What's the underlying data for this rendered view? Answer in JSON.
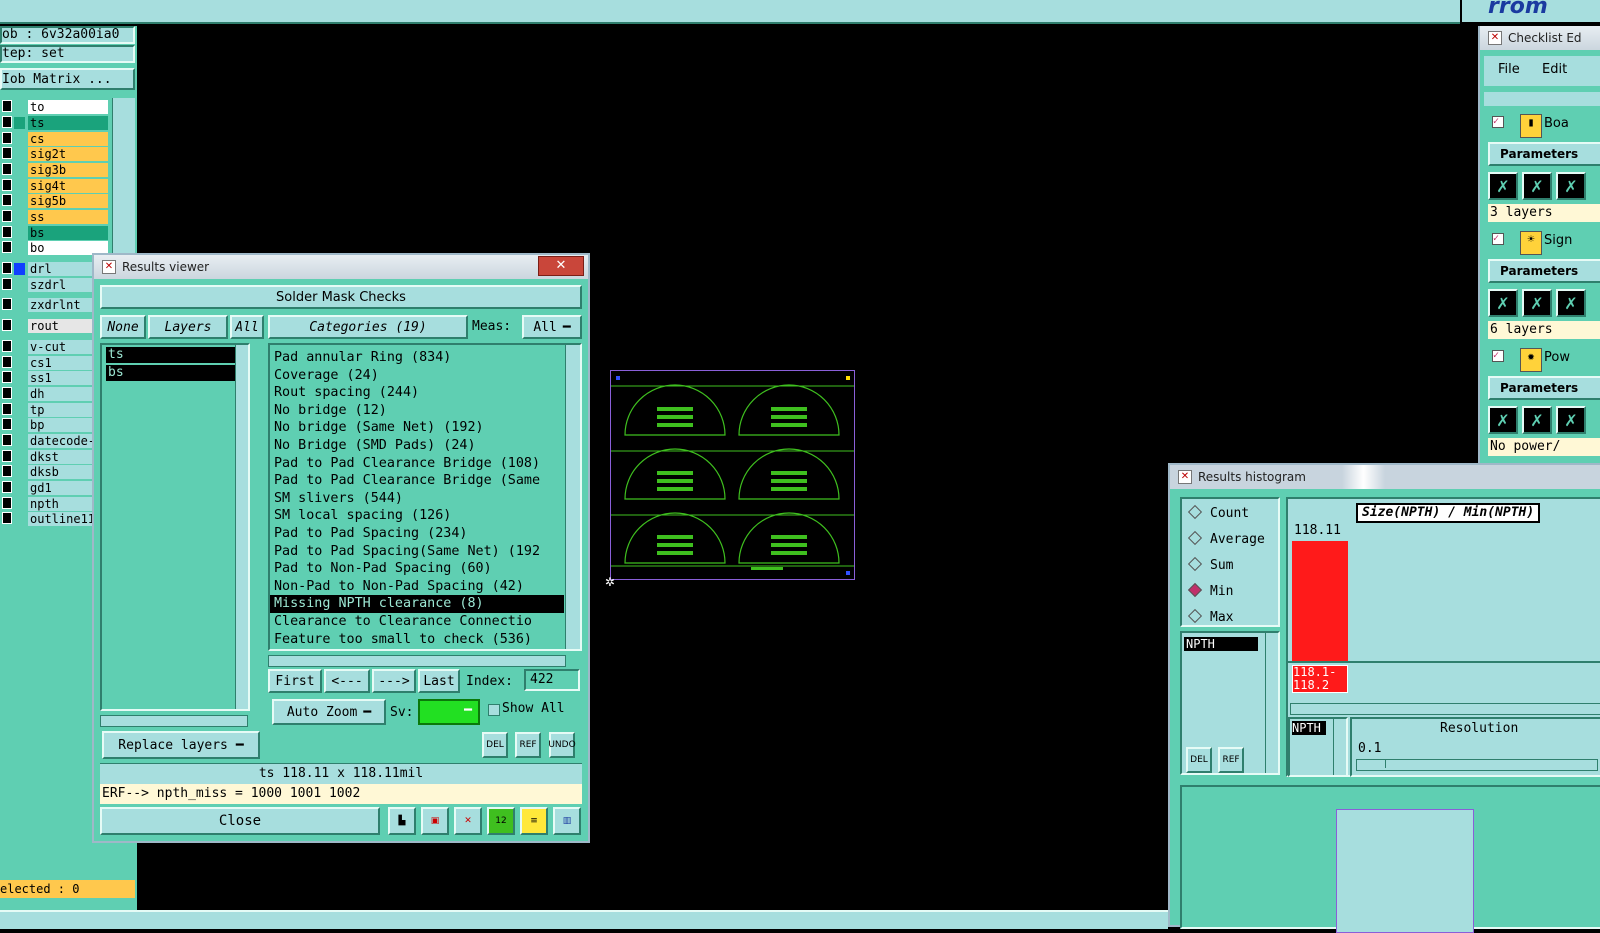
{
  "left_panel": {
    "job_label": "ob : 6v32a00ia0",
    "step_label": "tep: set",
    "job_matrix_button": "Iob Matrix ...",
    "selected_status": "elected : 0",
    "layers": [
      {
        "name": "to",
        "color": "#ffffff"
      },
      {
        "name": "ts",
        "color": "#1aa37c"
      },
      {
        "name": "cs",
        "color": "#ffc84d"
      },
      {
        "name": "sig2t",
        "color": "#ffc84d"
      },
      {
        "name": "sig3b",
        "color": "#ffc84d"
      },
      {
        "name": "sig4t",
        "color": "#ffc84d"
      },
      {
        "name": "sig5b",
        "color": "#ffc84d"
      },
      {
        "name": "ss",
        "color": "#ffc84d"
      },
      {
        "name": "bs",
        "color": "#1aa37c"
      },
      {
        "name": "bo",
        "color": "#ffffff"
      },
      {
        "name": "drl",
        "color": "#a7dede"
      },
      {
        "name": "szdrl",
        "color": "#a7dede"
      },
      {
        "name": "zxdrlnt",
        "color": "#a7dede"
      },
      {
        "name": "rout",
        "color": "#e6e6e6"
      },
      {
        "name": "v-cut",
        "color": "#a7dede"
      },
      {
        "name": "cs1",
        "color": "#a7dede"
      },
      {
        "name": "ss1",
        "color": "#a7dede"
      },
      {
        "name": "dh",
        "color": "#a7dede"
      },
      {
        "name": "tp",
        "color": "#a7dede"
      },
      {
        "name": "bp",
        "color": "#a7dede"
      },
      {
        "name": "datecode-j",
        "color": "#a7dede"
      },
      {
        "name": "dkst",
        "color": "#a7dede"
      },
      {
        "name": "dksb",
        "color": "#a7dede"
      },
      {
        "name": "gd1",
        "color": "#a7dede"
      },
      {
        "name": "npth",
        "color": "#a7dede"
      },
      {
        "name": "outline11",
        "color": "#a7dede"
      }
    ]
  },
  "results_viewer": {
    "window_title": "Results viewer",
    "header": "Solder Mask Checks",
    "none_button": "None",
    "layers_button": "Layers",
    "all_button": "All",
    "selected_layers": [
      "ts",
      "bs"
    ],
    "categories_button": "Categories (19)",
    "meas_label": "Meas:",
    "meas_value": "All",
    "categories": [
      "Pad annular Ring (834)",
      "Coverage (24)",
      "Rout spacing (244)",
      "No bridge (12)",
      "No bridge (Same Net) (192)",
      "No Bridge (SMD Pads) (24)",
      "Pad to Pad Clearance Bridge (108)",
      "Pad to Pad Clearance Bridge (Same",
      "SM slivers (544)",
      "SM local spacing (126)",
      "Pad to Pad Spacing (234)",
      "Pad to Pad Spacing(Same Net) (192",
      "Pad to Non-Pad Spacing (60)",
      "Non-Pad to Non-Pad Spacing (42)",
      "Missing NPTH clearance (8)",
      "Clearance to Clearance Connectio",
      "Feature too small to check (536)"
    ],
    "selected_category_index": 14,
    "nav_first": "First",
    "nav_prev": "<---",
    "nav_next": "--->",
    "nav_last": "Last",
    "index_label": "Index:",
    "index_value": "422",
    "auto_zoom": "Auto Zoom",
    "sv_label": "Sv:",
    "show_all": "Show All",
    "replace_layers": "Replace layers",
    "del_label": "DEL",
    "ref_label": "REF",
    "undo_label": "UNDO",
    "status_line": "ts 118.11 x 118.11mil",
    "erf_line": "ERF--> npth_miss = 1000 1001 1002",
    "close_button": "Close"
  },
  "checklist": {
    "window_title": "Checklist Ed",
    "menu": [
      "File",
      "Edit"
    ],
    "items": [
      {
        "name": "Boa",
        "params": "Parameters",
        "summary": "3 layers"
      },
      {
        "name": "Sign",
        "params": "Parameters",
        "summary": "6 layers"
      },
      {
        "name": "Pow",
        "params": "Parameters",
        "summary": "No power/"
      }
    ]
  },
  "histogram": {
    "window_title": "Results histogram",
    "modes": [
      "Count",
      "Average",
      "Sum",
      "Min",
      "Max"
    ],
    "selected_mode": "Min",
    "chart_title": "Size(NPTH) / Min(NPTH)",
    "bar_value": "118.11",
    "bin_label_1": "118.1-",
    "bin_label_2": "118.2",
    "list_item": "NPTH",
    "list_item_2": "NPTH",
    "resolution_label": "Resolution",
    "resolution_value": "0.1",
    "del_label": "DEL",
    "ref_label": "REF"
  },
  "colors": {
    "panel": "#5fcfb2",
    "light": "#a7dede",
    "bar": "#ff1a1a",
    "board": "#3fbf1f"
  }
}
